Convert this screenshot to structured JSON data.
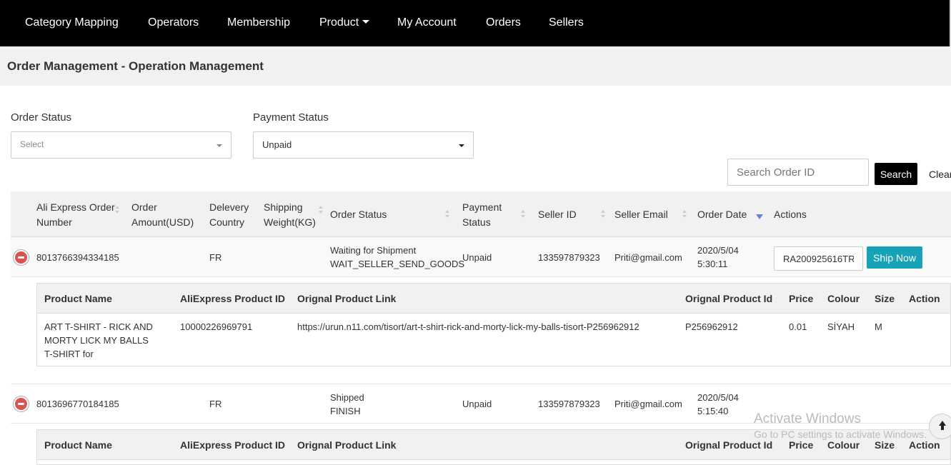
{
  "nav": {
    "items": [
      "Category Mapping",
      "Operators",
      "Membership",
      "Product",
      "My Account",
      "Orders",
      "Sellers"
    ]
  },
  "page": {
    "title": "Order Management - Operation Management"
  },
  "filters": {
    "order_status_label": "Order Status",
    "order_status_value": "Select",
    "payment_status_label": "Payment Status",
    "payment_status_value": "Unpaid"
  },
  "search": {
    "placeholder": "Search Order ID",
    "button": "Search",
    "clear": "Clear"
  },
  "table": {
    "columns": {
      "order_number": [
        "Ali Express Order",
        "Number"
      ],
      "amount": [
        "Order",
        "Amount(USD)"
      ],
      "country": [
        "Delevery",
        "Country"
      ],
      "weight": [
        "Shipping",
        "Weight(KG)"
      ],
      "order_status": "Order Status",
      "payment_status": [
        "Payment",
        "Status"
      ],
      "seller_id": "Seller ID",
      "seller_email": "Seller Email",
      "order_date": "Order Date",
      "actions": "Actions"
    },
    "orders": [
      {
        "order_number": "8013766394334185",
        "country": "FR",
        "status": "Waiting for Shipment",
        "status_code": "WAIT_SELLER_SEND_GOODS",
        "payment": "Unpaid",
        "seller_id": "133597879323",
        "seller_email": "Priti@gmail.com",
        "date": "2020/5/04",
        "time": "5:30:11",
        "tracking": "RA200925616TR",
        "ship_button": "Ship Now",
        "products": [
          {
            "name": "ART T-SHIRT - RICK AND MORTY LICK MY BALLS T-SHIRT for",
            "ali_id": "10000226969791",
            "link": "https://urun.n11.com/tisort/art-t-shirt-rick-and-morty-lick-my-balls-tisort-P256962912",
            "orig_id": "P256962912",
            "price": "0.01",
            "colour": "SİYAH",
            "size": "M"
          }
        ]
      },
      {
        "order_number": "8013696770184185",
        "country": "FR",
        "status": "Shipped",
        "status_code": "FINISH",
        "payment": "Unpaid",
        "seller_id": "133597879323",
        "seller_email": "Priti@gmail.com",
        "date": "2020/5/04",
        "time": "5:15:40"
      }
    ]
  },
  "sub_table": {
    "columns": [
      "Product Name",
      "AliExpress Product ID",
      "Orignal Product Link",
      "Orignal Product Id",
      "Price",
      "Colour",
      "Size",
      "Action"
    ]
  },
  "watermark": {
    "title": "Activate Windows",
    "subtitle": "Go to PC settings to activate Windows."
  }
}
